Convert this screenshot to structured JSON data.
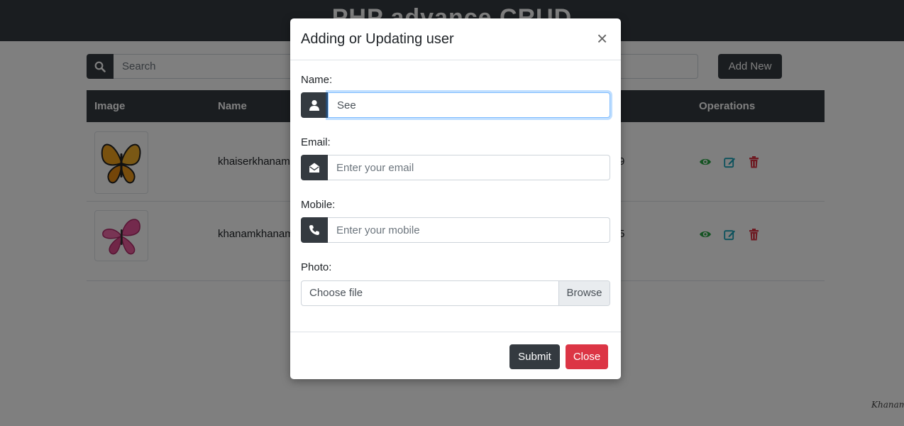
{
  "app": {
    "title": "PHP advance CRUD",
    "search": {
      "placeholder": "Search"
    },
    "add_new_label": "Add New",
    "table": {
      "headers": {
        "image": "Image",
        "name": "Name",
        "operations": "Operations"
      },
      "rows": [
        {
          "name": "khaiserkhanam",
          "extra": "9",
          "image_icon": "butterfly-orange-icon"
        },
        {
          "name": "khanamkhanam",
          "extra": "5",
          "image_icon": "butterfly-pink-icon"
        }
      ]
    }
  },
  "modal": {
    "title": "Adding or Updating user",
    "close_glyph": "×",
    "name_label": "Name:",
    "name_value": "See",
    "email_label": "Email:",
    "email_placeholder": "Enter your email",
    "mobile_label": "Mobile:",
    "mobile_placeholder": "Enter your mobile",
    "photo_label": "Photo:",
    "choose_file": "Choose file",
    "browse": "Browse",
    "submit": "Submit",
    "close": "Close"
  },
  "watermark": "Khanam",
  "colors": {
    "dark": "#343a40",
    "danger": "#dc3545",
    "view_icon": "#28a745",
    "edit_icon": "#17a2b8",
    "delete_icon": "#dc3545",
    "focus": "#80bdff"
  }
}
